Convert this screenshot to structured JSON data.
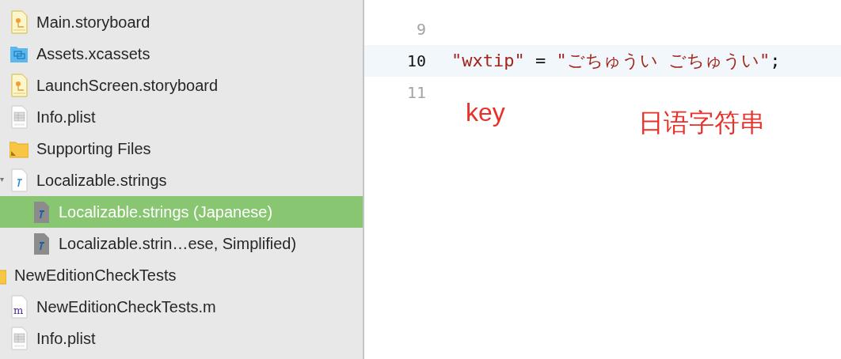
{
  "navigator": {
    "partial_group": {
      "children": [
        {
          "label": "Main.storyboard",
          "kind": "storyboard",
          "selected": false
        },
        {
          "label": "Assets.xcassets",
          "kind": "assets",
          "selected": false
        },
        {
          "label": "LaunchScreen.storyboard",
          "kind": "storyboard",
          "selected": false
        },
        {
          "label": "Info.plist",
          "kind": "plist",
          "selected": false
        },
        {
          "label": "Supporting Files",
          "kind": "folder",
          "selected": false
        },
        {
          "label": "Localizable.strings",
          "kind": "strings",
          "selected": false,
          "expanded": true,
          "children": [
            {
              "label": "Localizable.strings (Japanese)",
              "kind": "localized",
              "selected": true
            },
            {
              "label": "Localizable.strin…ese, Simplified)",
              "kind": "localized",
              "selected": false
            }
          ]
        }
      ]
    },
    "groups": [
      {
        "label": "NewEditionCheckTests",
        "kind": "folder",
        "selected": false,
        "children": [
          {
            "label": "NewEditionCheckTests.m",
            "kind": "mfile",
            "glyph": "m",
            "selected": false
          },
          {
            "label": "Info.plist",
            "kind": "plist",
            "selected": false
          }
        ]
      }
    ]
  },
  "editor": {
    "lines": [
      {
        "number": "9",
        "current": false
      },
      {
        "number": "10",
        "current": true,
        "tokens": [
          {
            "kind": "string",
            "text": "\"wxtip\""
          },
          {
            "kind": "plain",
            "text": " = "
          },
          {
            "kind": "string",
            "text": "\"ごちゅうい ごちゅうい\""
          },
          {
            "kind": "plain",
            "text": ";"
          }
        ]
      },
      {
        "number": "11",
        "current": false
      }
    ],
    "annotations": [
      {
        "text": "key",
        "kind": "key"
      },
      {
        "text": "日语字符串",
        "kind": "value"
      }
    ]
  }
}
